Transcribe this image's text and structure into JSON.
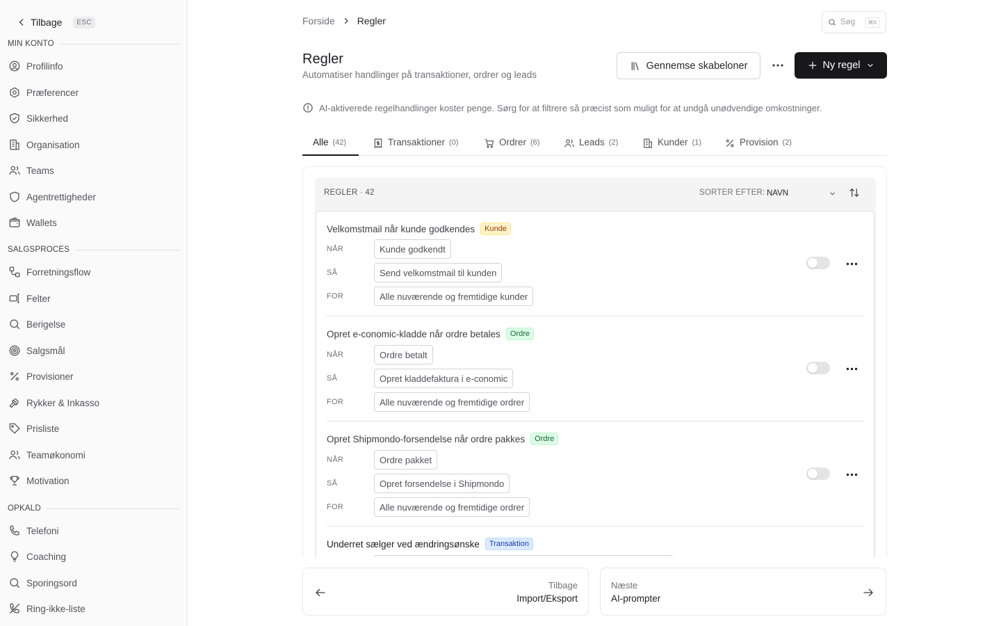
{
  "sidebar": {
    "back_label": "Tilbage",
    "esc_label": "ESC",
    "sections": [
      {
        "label": "MIN KONTO",
        "items": [
          {
            "label": "Profilinfo",
            "icon": "user-circle-icon"
          },
          {
            "label": "Præferencer",
            "icon": "settings-icon"
          },
          {
            "label": "Sikkerhed",
            "icon": "shield-check-icon"
          },
          {
            "label": "Organisation",
            "icon": "building-icon"
          },
          {
            "label": "Teams",
            "icon": "users-icon"
          },
          {
            "label": "Agentrettigheder",
            "icon": "shield-icon"
          },
          {
            "label": "Wallets",
            "icon": "wallet-icon"
          }
        ]
      },
      {
        "label": "SALGSPROCES",
        "items": [
          {
            "label": "Forretningsflow",
            "icon": "flow-icon"
          },
          {
            "label": "Felter",
            "icon": "fields-icon"
          },
          {
            "label": "Berigelse",
            "icon": "search-icon"
          },
          {
            "label": "Salgsmål",
            "icon": "target-icon"
          },
          {
            "label": "Provisioner",
            "icon": "percent-icon"
          },
          {
            "label": "Rykker & Inkasso",
            "icon": "gavel-icon"
          },
          {
            "label": "Prisliste",
            "icon": "tag-icon"
          },
          {
            "label": "Teamøkonomi",
            "icon": "users-icon"
          },
          {
            "label": "Motivation",
            "icon": "trophy-icon"
          }
        ]
      },
      {
        "label": "OPKALD",
        "items": [
          {
            "label": "Telefoni",
            "icon": "phone-icon"
          },
          {
            "label": "Coaching",
            "icon": "lightbulb-icon"
          },
          {
            "label": "Sporingsord",
            "icon": "search-icon"
          },
          {
            "label": "Ring-ikke-liste",
            "icon": "phone-off-icon"
          }
        ]
      }
    ]
  },
  "breadcrumb": {
    "home": "Forside",
    "current": "Regler"
  },
  "search": {
    "placeholder": "Søg",
    "shortcut": "⌘K"
  },
  "header": {
    "title": "Regler",
    "subtitle": "Automatiser handlinger på transaktioner, ordrer og leads",
    "templates_button": "Gennemse skabeloner",
    "new_button": "Ny regel"
  },
  "notice": "AI-aktiverede regelhandlinger koster penge. Sørg for at filtrere så præcist som muligt for at undgå unødvendige omkostninger.",
  "tabs": [
    {
      "label": "Alle",
      "count": "(42)",
      "icon": ""
    },
    {
      "label": "Transaktioner",
      "count": "(0)",
      "icon": "receipt-icon"
    },
    {
      "label": "Ordrer",
      "count": "(6)",
      "icon": "cart-icon"
    },
    {
      "label": "Leads",
      "count": "(2)",
      "icon": "users-icon"
    },
    {
      "label": "Kunder",
      "count": "(1)",
      "icon": "building-icon"
    },
    {
      "label": "Provision",
      "count": "(2)",
      "icon": "percent-icon"
    }
  ],
  "list": {
    "header": "REGLER",
    "separator": "·",
    "count": "42",
    "sort_label": "SORTER EFTER:",
    "sort_value": "NAVN"
  },
  "rule_labels": {
    "when": "NÅR",
    "then": "SÅ",
    "for": "FOR"
  },
  "rules": [
    {
      "title": "Velkomstmail når kunde godkendes",
      "tag": "Kunde",
      "when": "Kunde godkendt",
      "then": "Send velkomstmail til kunden",
      "for": "Alle nuværende og fremtidige kunder"
    },
    {
      "title": "Opret e-conomic-kladde når ordre betales",
      "tag": "Ordre",
      "when": "Ordre betalt",
      "then": "Opret kladdefaktura i e-conomic",
      "for": "Alle nuværende og fremtidige ordrer"
    },
    {
      "title": "Opret Shipmondo-forsendelse når ordre pakkes",
      "tag": "Ordre",
      "when": "Ordre pakket",
      "then": "Opret forsendelse i Shipmondo",
      "for": "Alle nuværende og fremtidige ordrer"
    },
    {
      "title": "Underret sælger ved ændringsønske",
      "tag": "Transaktion"
    }
  ],
  "footer_nav": {
    "prev_small": "Tilbage",
    "prev_big": "Import/Eksport",
    "next_small": "Næste",
    "next_big": "AI-prompter"
  }
}
